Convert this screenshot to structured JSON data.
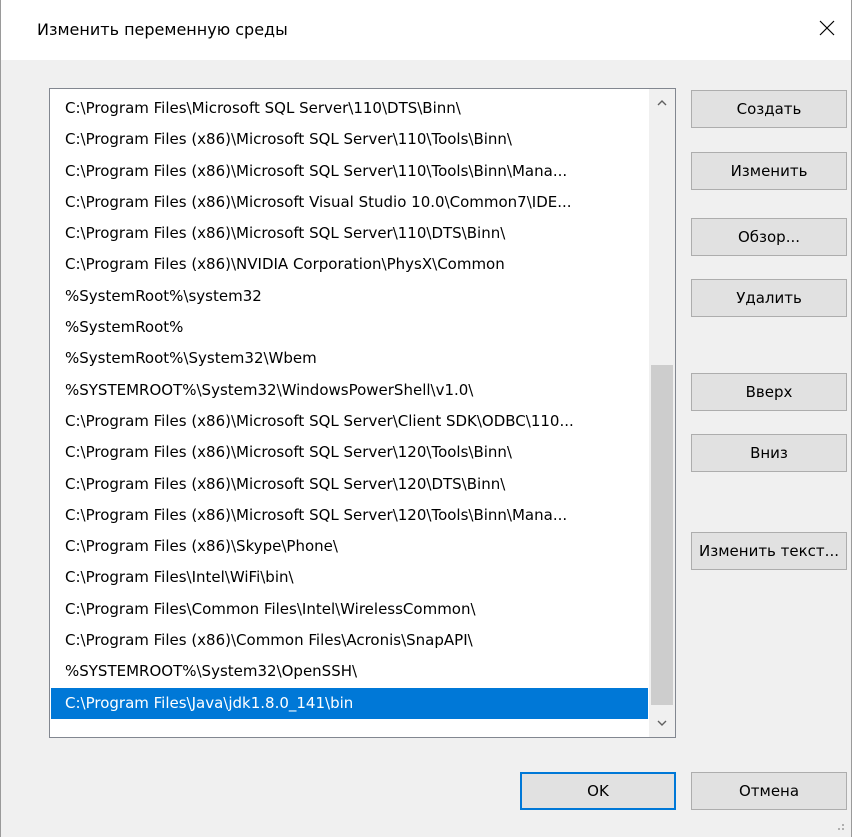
{
  "dialog": {
    "title": "Изменить переменную среды",
    "close_icon": "close-icon"
  },
  "paths": [
    "C:\\Program Files\\Microsoft SQL Server\\110\\DTS\\Binn\\",
    "C:\\Program Files (x86)\\Microsoft SQL Server\\110\\Tools\\Binn\\",
    "C:\\Program Files (x86)\\Microsoft SQL Server\\110\\Tools\\Binn\\Mana...",
    "C:\\Program Files (x86)\\Microsoft Visual Studio 10.0\\Common7\\IDE...",
    "C:\\Program Files (x86)\\Microsoft SQL Server\\110\\DTS\\Binn\\",
    "C:\\Program Files (x86)\\NVIDIA Corporation\\PhysX\\Common",
    "%SystemRoot%\\system32",
    "%SystemRoot%",
    "%SystemRoot%\\System32\\Wbem",
    "%SYSTEMROOT%\\System32\\WindowsPowerShell\\v1.0\\",
    "C:\\Program Files (x86)\\Microsoft SQL Server\\Client SDK\\ODBC\\110...",
    "C:\\Program Files (x86)\\Microsoft SQL Server\\120\\Tools\\Binn\\",
    "C:\\Program Files (x86)\\Microsoft SQL Server\\120\\DTS\\Binn\\",
    "C:\\Program Files (x86)\\Microsoft SQL Server\\120\\Tools\\Binn\\Mana...",
    "C:\\Program Files (x86)\\Skype\\Phone\\",
    "C:\\Program Files\\Intel\\WiFi\\bin\\",
    "C:\\Program Files\\Common Files\\Intel\\WirelessCommon\\",
    "C:\\Program Files (x86)\\Common Files\\Acronis\\SnapAPI\\",
    "%SYSTEMROOT%\\System32\\OpenSSH\\",
    "C:\\Program Files\\Java\\jdk1.8.0_141\\bin"
  ],
  "selected_index": 19,
  "buttons": {
    "create": "Создать",
    "edit": "Изменить",
    "browse": "Обзор...",
    "delete": "Удалить",
    "up": "Вверх",
    "down": "Вниз",
    "edit_text": "Изменить текст...",
    "ok": "OK",
    "cancel": "Отмена"
  },
  "colors": {
    "selection": "#0078d7",
    "dialog_bg": "#f0f0f0"
  }
}
